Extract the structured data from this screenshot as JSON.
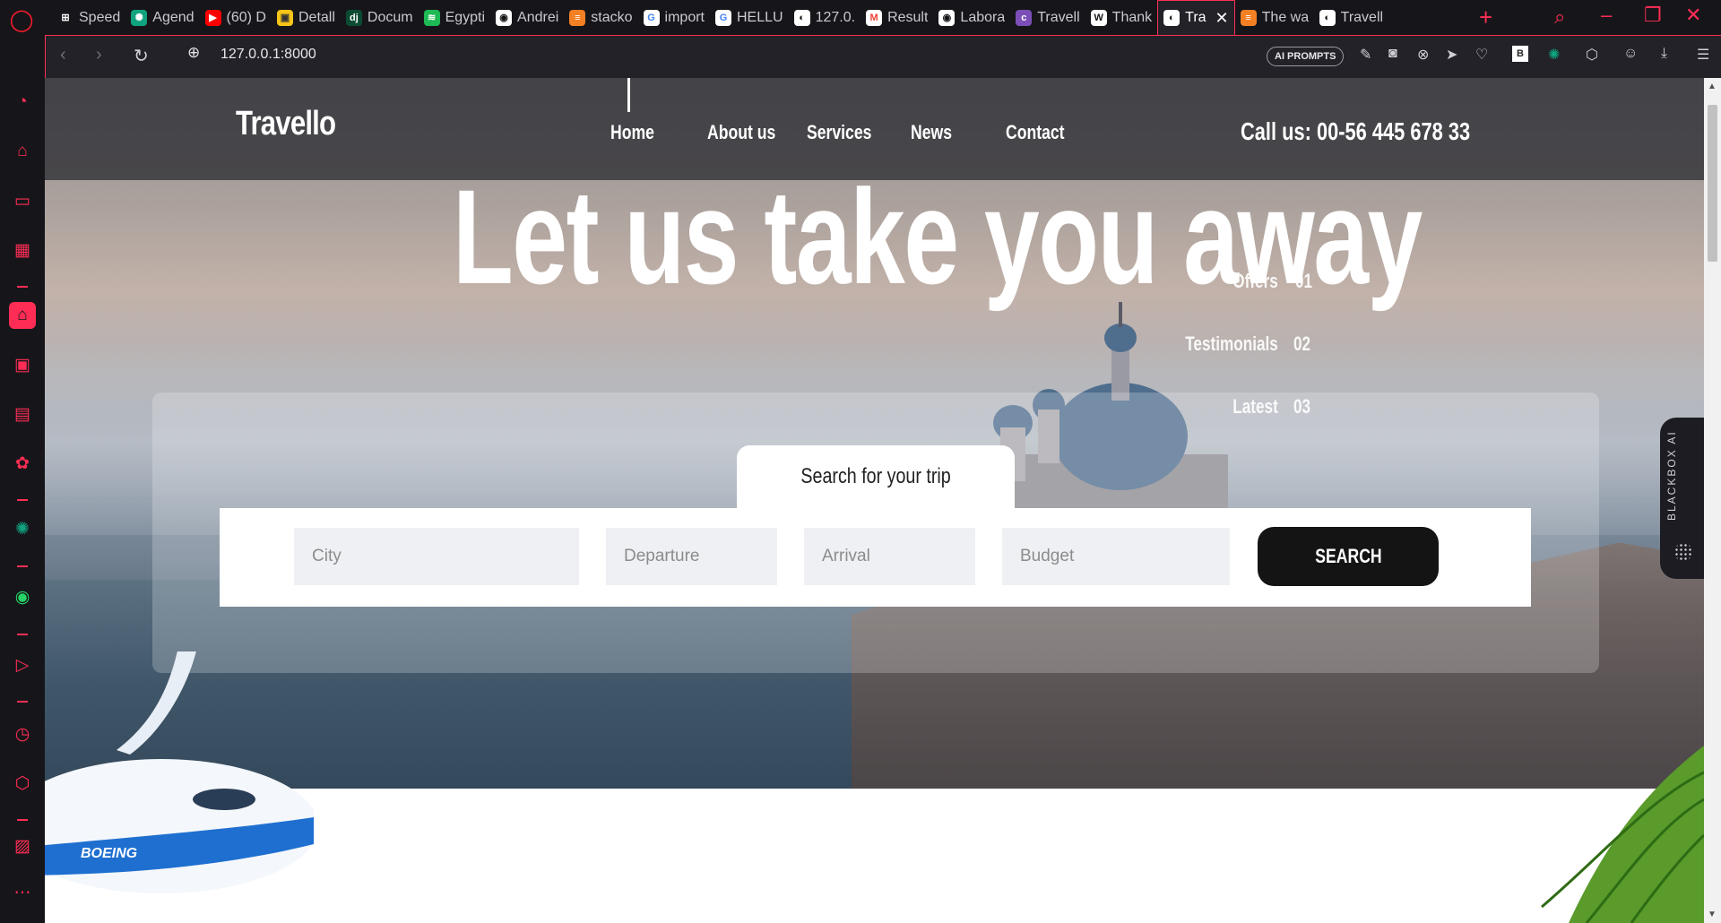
{
  "browser": {
    "tabs": [
      {
        "title": "Speed",
        "fav": "⊞",
        "color": "#ffffff",
        "bg": "#16161a"
      },
      {
        "title": "Agend",
        "fav": "✺",
        "color": "#ffffff",
        "bg": "#10a37f"
      },
      {
        "title": "(60) D",
        "fav": "▶",
        "color": "#ffffff",
        "bg": "#ff0000"
      },
      {
        "title": "Detall",
        "fav": "▣",
        "color": "#333333",
        "bg": "#f5c518"
      },
      {
        "title": "Docum",
        "fav": "dj",
        "color": "#ffffff",
        "bg": "#0c4b33"
      },
      {
        "title": "Egypti",
        "fav": "≋",
        "color": "#ffffff",
        "bg": "#1db954"
      },
      {
        "title": "Andrei",
        "fav": "◉",
        "color": "#16161a",
        "bg": "#ffffff"
      },
      {
        "title": "stacko",
        "fav": "≡",
        "color": "#ffffff",
        "bg": "#f48024"
      },
      {
        "title": "import",
        "fav": "G",
        "color": "#4285f4",
        "bg": "#ffffff"
      },
      {
        "title": "HELLU",
        "fav": "G",
        "color": "#4285f4",
        "bg": "#ffffff"
      },
      {
        "title": "127.0.",
        "fav": "◐",
        "color": "#16161a",
        "bg": "#ffffff"
      },
      {
        "title": "Result",
        "fav": "M",
        "color": "#ea4335",
        "bg": "#ffffff"
      },
      {
        "title": "Labora",
        "fav": "◉",
        "color": "#16161a",
        "bg": "#ffffff"
      },
      {
        "title": "Travell",
        "fav": "c",
        "color": "#ffffff",
        "bg": "#7b4fb7"
      },
      {
        "title": "Thank",
        "fav": "W",
        "color": "#16161a",
        "bg": "#ffffff"
      },
      {
        "title": "Tra",
        "fav": "◐",
        "color": "#16161a",
        "bg": "#ffffff",
        "active": true
      },
      {
        "title": "The wa",
        "fav": "≡",
        "color": "#ffffff",
        "bg": "#f48024"
      },
      {
        "title": "Travell",
        "fav": "◐",
        "color": "#16161a",
        "bg": "#ffffff"
      }
    ],
    "url": "127.0.0.1:8000",
    "ai_prompts_label": "AI PROMPTS",
    "accent_color": "#ff2d55"
  },
  "site": {
    "logo": "Travello",
    "nav": [
      "Home",
      "About us",
      "Services",
      "News",
      "Contact"
    ],
    "phone": "Call us: 00-56 445 678 33",
    "hero_title": "Let us take you away",
    "side_links": [
      {
        "label": "Offers",
        "num": "01"
      },
      {
        "label": "Testimonials",
        "num": "02"
      },
      {
        "label": "Latest",
        "num": "03"
      }
    ],
    "search": {
      "tab_label": "Search for your trip",
      "city_placeholder": "City",
      "departure_placeholder": "Departure",
      "arrival_placeholder": "Arrival",
      "budget_placeholder": "Budget",
      "button_label": "SEARCH"
    },
    "blackbox_label": "BLACKBOX AI",
    "plane_text": "BOEING"
  }
}
